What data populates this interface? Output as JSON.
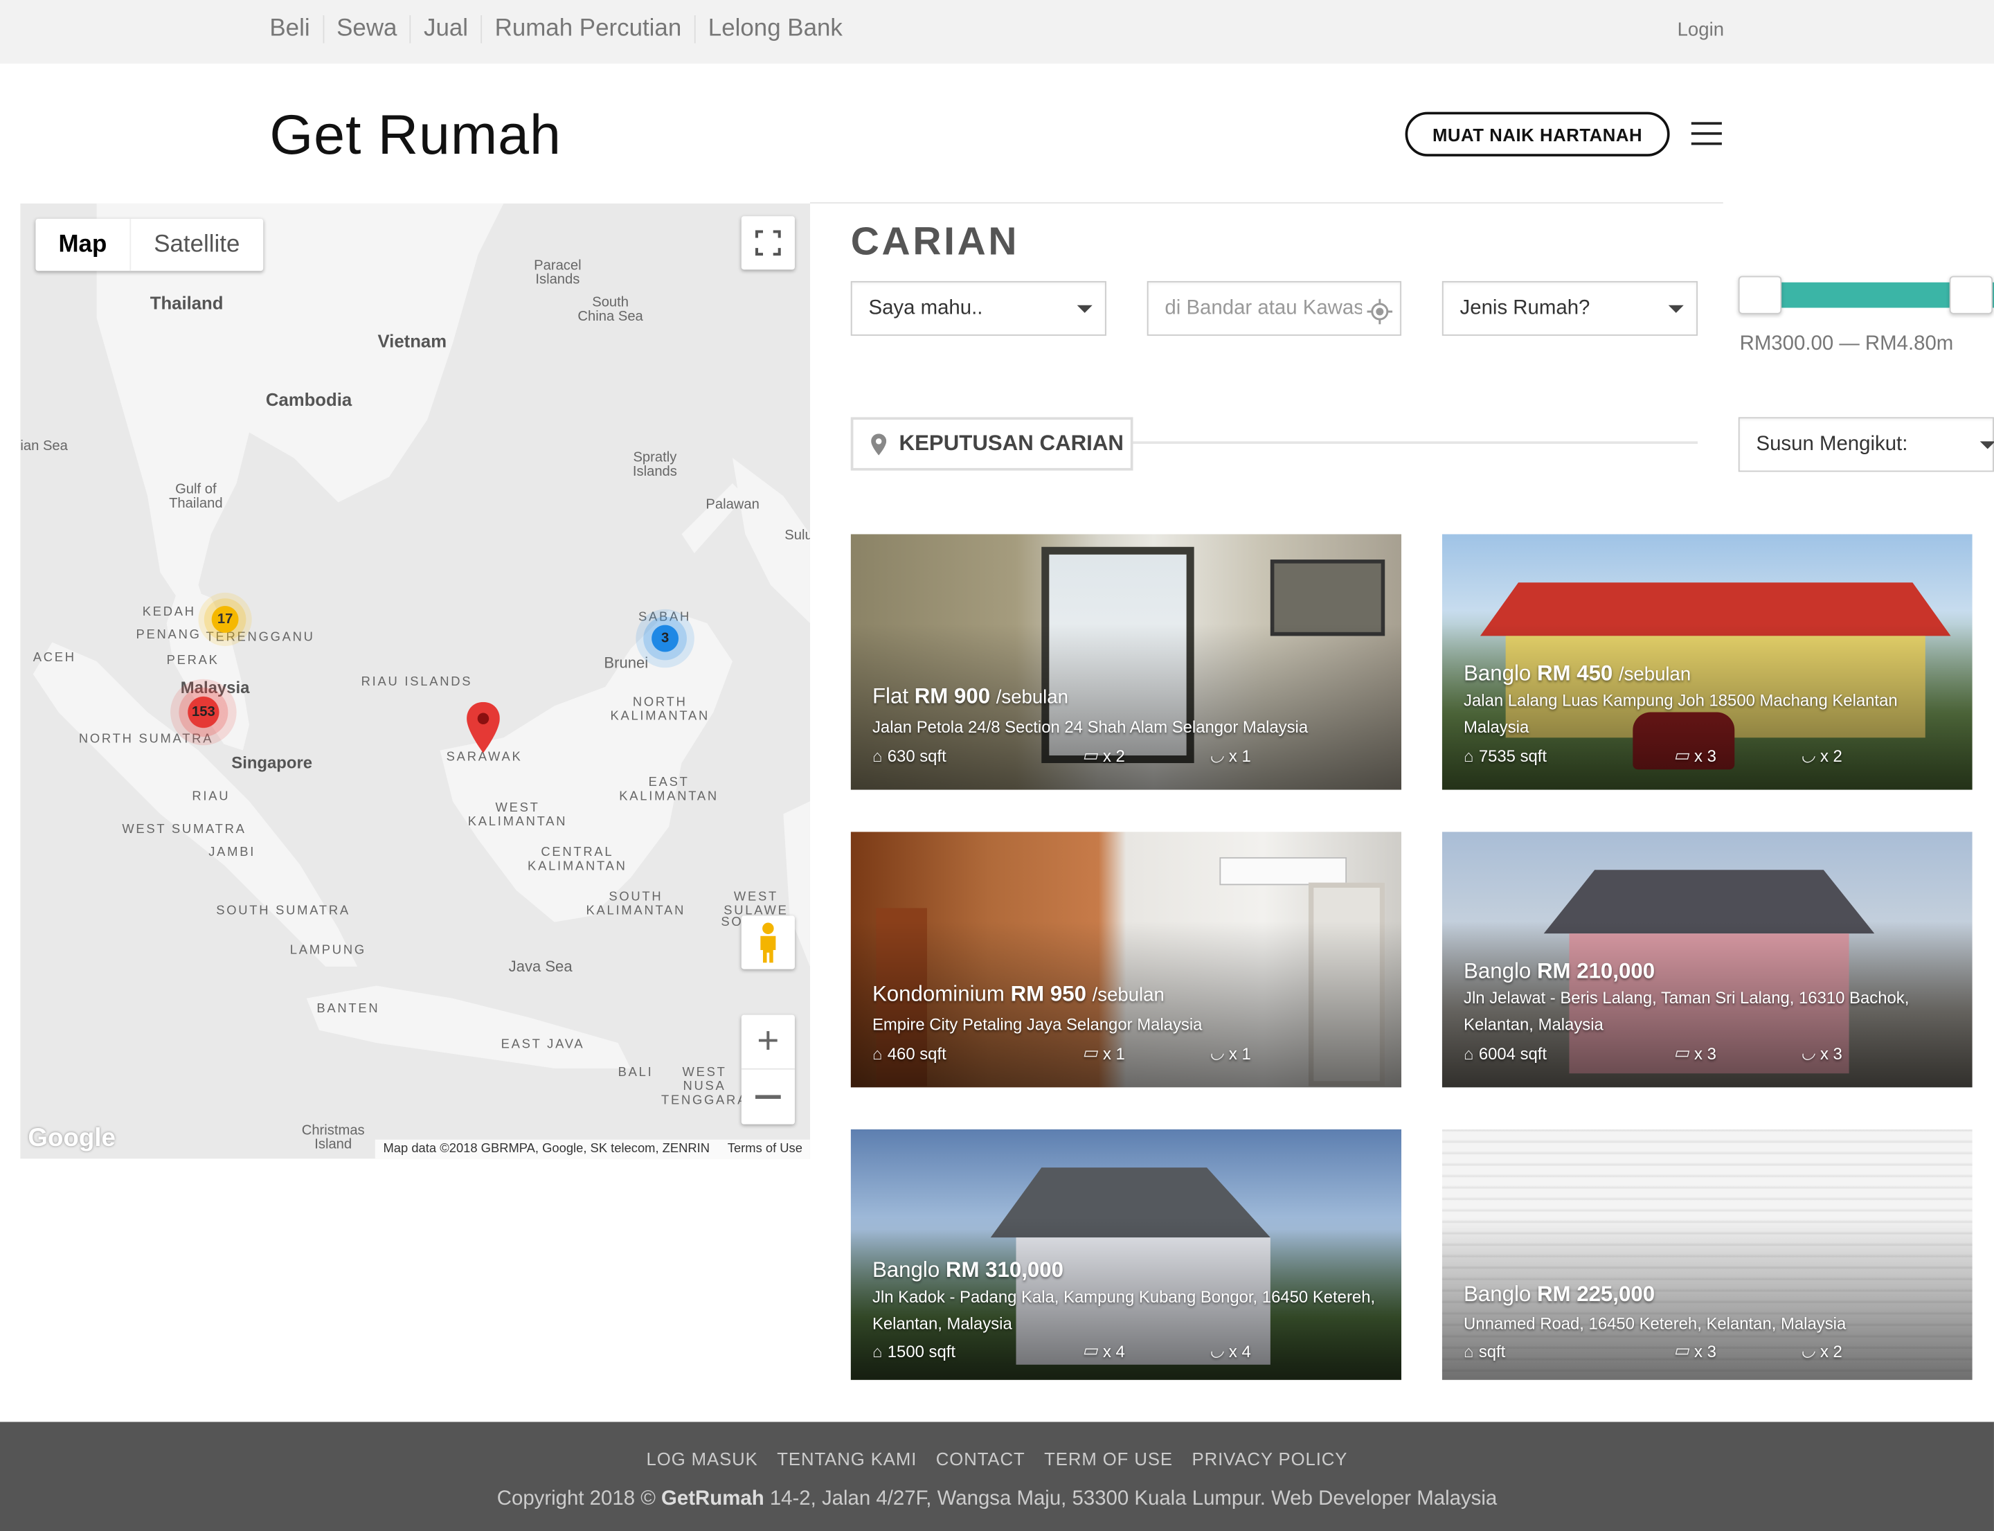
{
  "topnav": {
    "items": [
      "Beli",
      "Sewa",
      "Jual",
      "Rumah Percutian",
      "Lelong Bank"
    ],
    "login": "Login"
  },
  "header": {
    "logo": "Get Rumah",
    "upload_button": "MUAT NAIK HARTANAH"
  },
  "map": {
    "type_map": "Map",
    "type_satellite": "Satellite",
    "attribution": "Map data ©2018 GBRMPA, Google, SK telecom, ZENRIN",
    "terms": "Terms of Use",
    "google": "Google",
    "clusters": [
      {
        "count": "17",
        "color": "#f5b800"
      },
      {
        "count": "153",
        "color": "#e53935"
      },
      {
        "count": "3",
        "color": "#1e88e5"
      }
    ],
    "labels": {
      "thailand": "Thailand",
      "vietnam": "Vietnam",
      "cambodia": "Cambodia",
      "paracel": "Paracel Islands",
      "scs": "South China Sea",
      "andaman": "ian Sea",
      "gulf": "Gulf of Thailand",
      "spratly": "Spratly Islands",
      "palawan": "Palawan",
      "sulu": "Sulu",
      "kedah": "KEDAH",
      "penang": "PENANG",
      "terengganu": "TERENGGANU",
      "aceh": "ACEH",
      "perak": "PERAK",
      "malaysia": "Malaysia",
      "sabah": "SABAH",
      "brunei": "Brunei",
      "riau_islands": "RIAU ISLANDS",
      "north_kalimantan": "NORTH KALIMANTAN",
      "north_sumatra": "NORTH SUMATRA",
      "sarawak": "SARAWAK",
      "singapore": "Singapore",
      "riau": "RIAU",
      "west_kalimantan": "WEST KALIMANTAN",
      "east_kalimantan": "EAST KALIMANTAN",
      "west_sumatra": "WEST SUMATRA",
      "jambi": "JAMBI",
      "central_kalimantan": "CENTRAL KALIMANTAN",
      "south_kalimantan": "SOUTH KALIMANTAN",
      "west_sulawesi": "WEST SULAWE",
      "south_sumatra": "SOUTH SUMATRA",
      "lampung": "LAMPUNG",
      "java_sea": "Java Sea",
      "banten": "BANTEN",
      "east_java": "EAST JAVA",
      "bali": "BALI",
      "wnt": "WEST NUSA TENGGARA",
      "christmas": "Christmas Island",
      "so": "SO"
    }
  },
  "search": {
    "title": "CARIAN",
    "want": "Saya mahu..",
    "location_placeholder": "di Bandar atau Kawasan",
    "type": "Jenis Rumah?",
    "range": "RM300.00 — RM4.80m",
    "results_label": "KEPUTUSAN CARIAN",
    "sort": "Susun Mengikut:"
  },
  "listings": [
    {
      "type": "Flat",
      "price": "RM 900",
      "period": "/sebulan",
      "address": "Jalan Petola 24/8 Section 24 Shah Alam Selangor Malaysia",
      "sqft": "630 sqft",
      "beds": "x 2",
      "baths": "x 1"
    },
    {
      "type": "Banglo",
      "price": "RM 450",
      "period": "/sebulan",
      "address": "Jalan Lalang Luas Kampung Joh 18500 Machang Kelantan Malaysia",
      "sqft": "7535 sqft",
      "beds": "x 3",
      "baths": "x 2"
    },
    {
      "type": "Kondominium",
      "price": "RM 950",
      "period": "/sebulan",
      "address": "Empire City Petaling Jaya Selangor Malaysia",
      "sqft": "460 sqft",
      "beds": "x 1",
      "baths": "x 1"
    },
    {
      "type": "Banglo",
      "price": "RM 210,000",
      "period": "",
      "address": "Jln Jelawat - Beris Lalang, Taman Sri Lalang, 16310 Bachok, Kelantan, Malaysia",
      "sqft": "6004 sqft",
      "beds": "x 3",
      "baths": "x 3"
    },
    {
      "type": "Banglo",
      "price": "RM 310,000",
      "period": "",
      "address": "Jln Kadok - Padang Kala, Kampung Kubang Bongor, 16450 Ketereh, Kelantan, Malaysia",
      "sqft": "1500 sqft",
      "beds": "x 4",
      "baths": "x 4"
    },
    {
      "type": "Banglo",
      "price": "RM 225,000",
      "period": "",
      "address": "Unnamed Road, 16450 Ketereh, Kelantan, Malaysia",
      "sqft": "sqft",
      "beds": "x 3",
      "baths": "x 2"
    }
  ],
  "footer": {
    "links": [
      "LOG MASUK",
      "TENTANG KAMI",
      "CONTACT",
      "TERM OF USE",
      "PRIVACY POLICY"
    ],
    "copy_pre": "Copyright 2018 © ",
    "copy_brand": "GetRumah",
    "copy_post": " 14-2, Jalan 4/27F, Wangsa Maju, 53300 Kuala Lumpur. Web Developer Malaysia"
  },
  "colors": {
    "accent": "#3bb5a6",
    "footer_bg": "#555555",
    "marker": "#e53935"
  }
}
